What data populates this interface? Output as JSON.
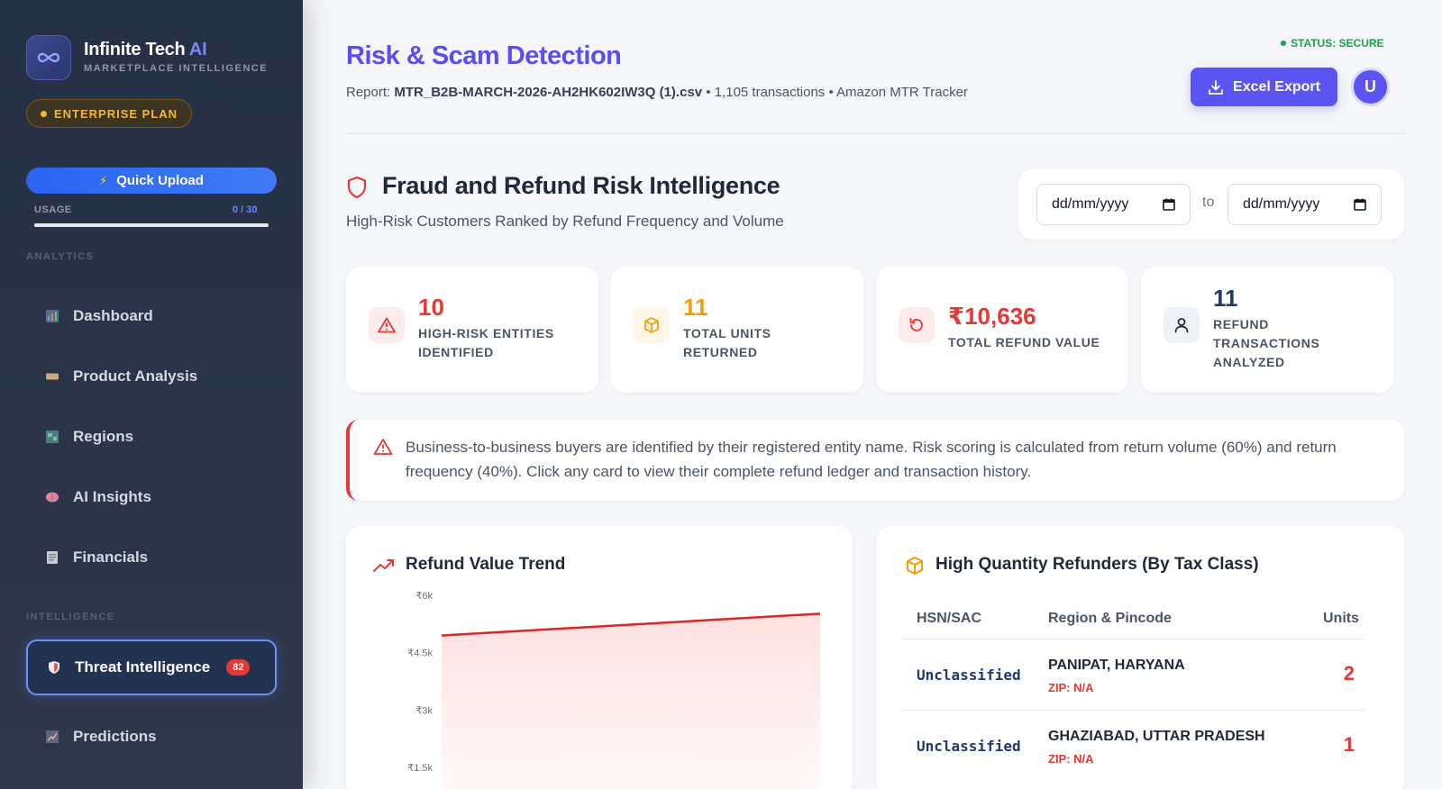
{
  "sidebar": {
    "brand_name": "Infinite Tech",
    "brand_ai": "AI",
    "brand_subtitle": "MARKETPLACE INTELLIGENCE",
    "plan": "ENTERPRISE PLAN",
    "quick_upload": "Quick Upload",
    "usage_label": "USAGE",
    "usage_count": "0 / 30",
    "usage_fraction": 1.0,
    "section_analytics": "ANALYTICS",
    "section_intelligence": "INTELLIGENCE",
    "items": [
      {
        "label": "Dashboard",
        "icon": "bar-chart-icon"
      },
      {
        "label": "Product Analysis",
        "icon": "tag-icon"
      },
      {
        "label": "Regions",
        "icon": "map-icon"
      },
      {
        "label": "AI Insights",
        "icon": "brain-icon"
      },
      {
        "label": "Financials",
        "icon": "receipt-icon"
      },
      {
        "label": "Threat Intelligence",
        "icon": "shield-icon",
        "badge": "82",
        "active": true
      },
      {
        "label": "Predictions",
        "icon": "trend-chart-icon"
      }
    ]
  },
  "header": {
    "title": "Risk & Scam Detection",
    "report_label": "Report:",
    "report_file": "MTR_B2B-MARCH-2026-AH2HK602IW3Q (1).csv",
    "report_meta": " • 1,105 transactions • Amazon MTR Tracker",
    "status": "STATUS: SECURE",
    "export_label": "Excel Export",
    "avatar_initial": "U"
  },
  "section": {
    "title": "Fraud and Refund Risk Intelligence",
    "subtitle": "High-Risk Customers Ranked by Refund Frequency and Volume",
    "date_from": "dd/mm/yyyy",
    "date_to": "dd/mm/yyyy",
    "date_separator": "to"
  },
  "kpis": [
    {
      "value": "10",
      "label_line1": "HIGH-RISK ENTITIES",
      "label_line2": "IDENTIFIED",
      "color": "#e53935"
    },
    {
      "value": "11",
      "label_line1": "TOTAL UNITS",
      "label_line2": "RETURNED",
      "color": "#f59e0b"
    },
    {
      "value": "₹10,636",
      "label_line1": "TOTAL REFUND VALUE",
      "label_line2": "",
      "color": "#e53935"
    },
    {
      "value": "11",
      "label_line1": "REFUND",
      "label_line2": "TRANSACTIONS",
      "label_line3": "ANALYZED",
      "color": "#1e3a6e"
    }
  ],
  "alert": {
    "text": "Business-to-business buyers are identified by their registered entity name. Risk scoring is calculated from return volume (60%) and return frequency (40%). Click any card to view their complete refund ledger and transaction history."
  },
  "trend_panel": {
    "title": "Refund Value Trend"
  },
  "refunders_panel": {
    "title": "High Quantity Refunders (By Tax Class)",
    "columns": [
      "HSN/SAC",
      "Region & Pincode",
      "Units"
    ],
    "rows": [
      {
        "hsn": "Unclassified",
        "region": "PANIPAT, HARYANA",
        "zip": "ZIP: N/A",
        "units": "2"
      },
      {
        "hsn": "Unclassified",
        "region": "GHAZIABAD, UTTAR PRADESH",
        "zip": "ZIP: N/A",
        "units": "1"
      }
    ]
  },
  "chart_data": {
    "type": "area",
    "title": "Refund Value Trend",
    "xlabel": "",
    "ylabel": "",
    "y_tick_labels": [
      "₹6k",
      "₹4.5k",
      "₹3k",
      "₹1.5k"
    ],
    "y_ticks": [
      6000,
      4500,
      3000,
      1500
    ],
    "ylim": [
      0,
      6000
    ],
    "x": [
      0,
      1
    ],
    "values": [
      4950,
      5520
    ],
    "color": "#dc2626",
    "grid": false
  }
}
